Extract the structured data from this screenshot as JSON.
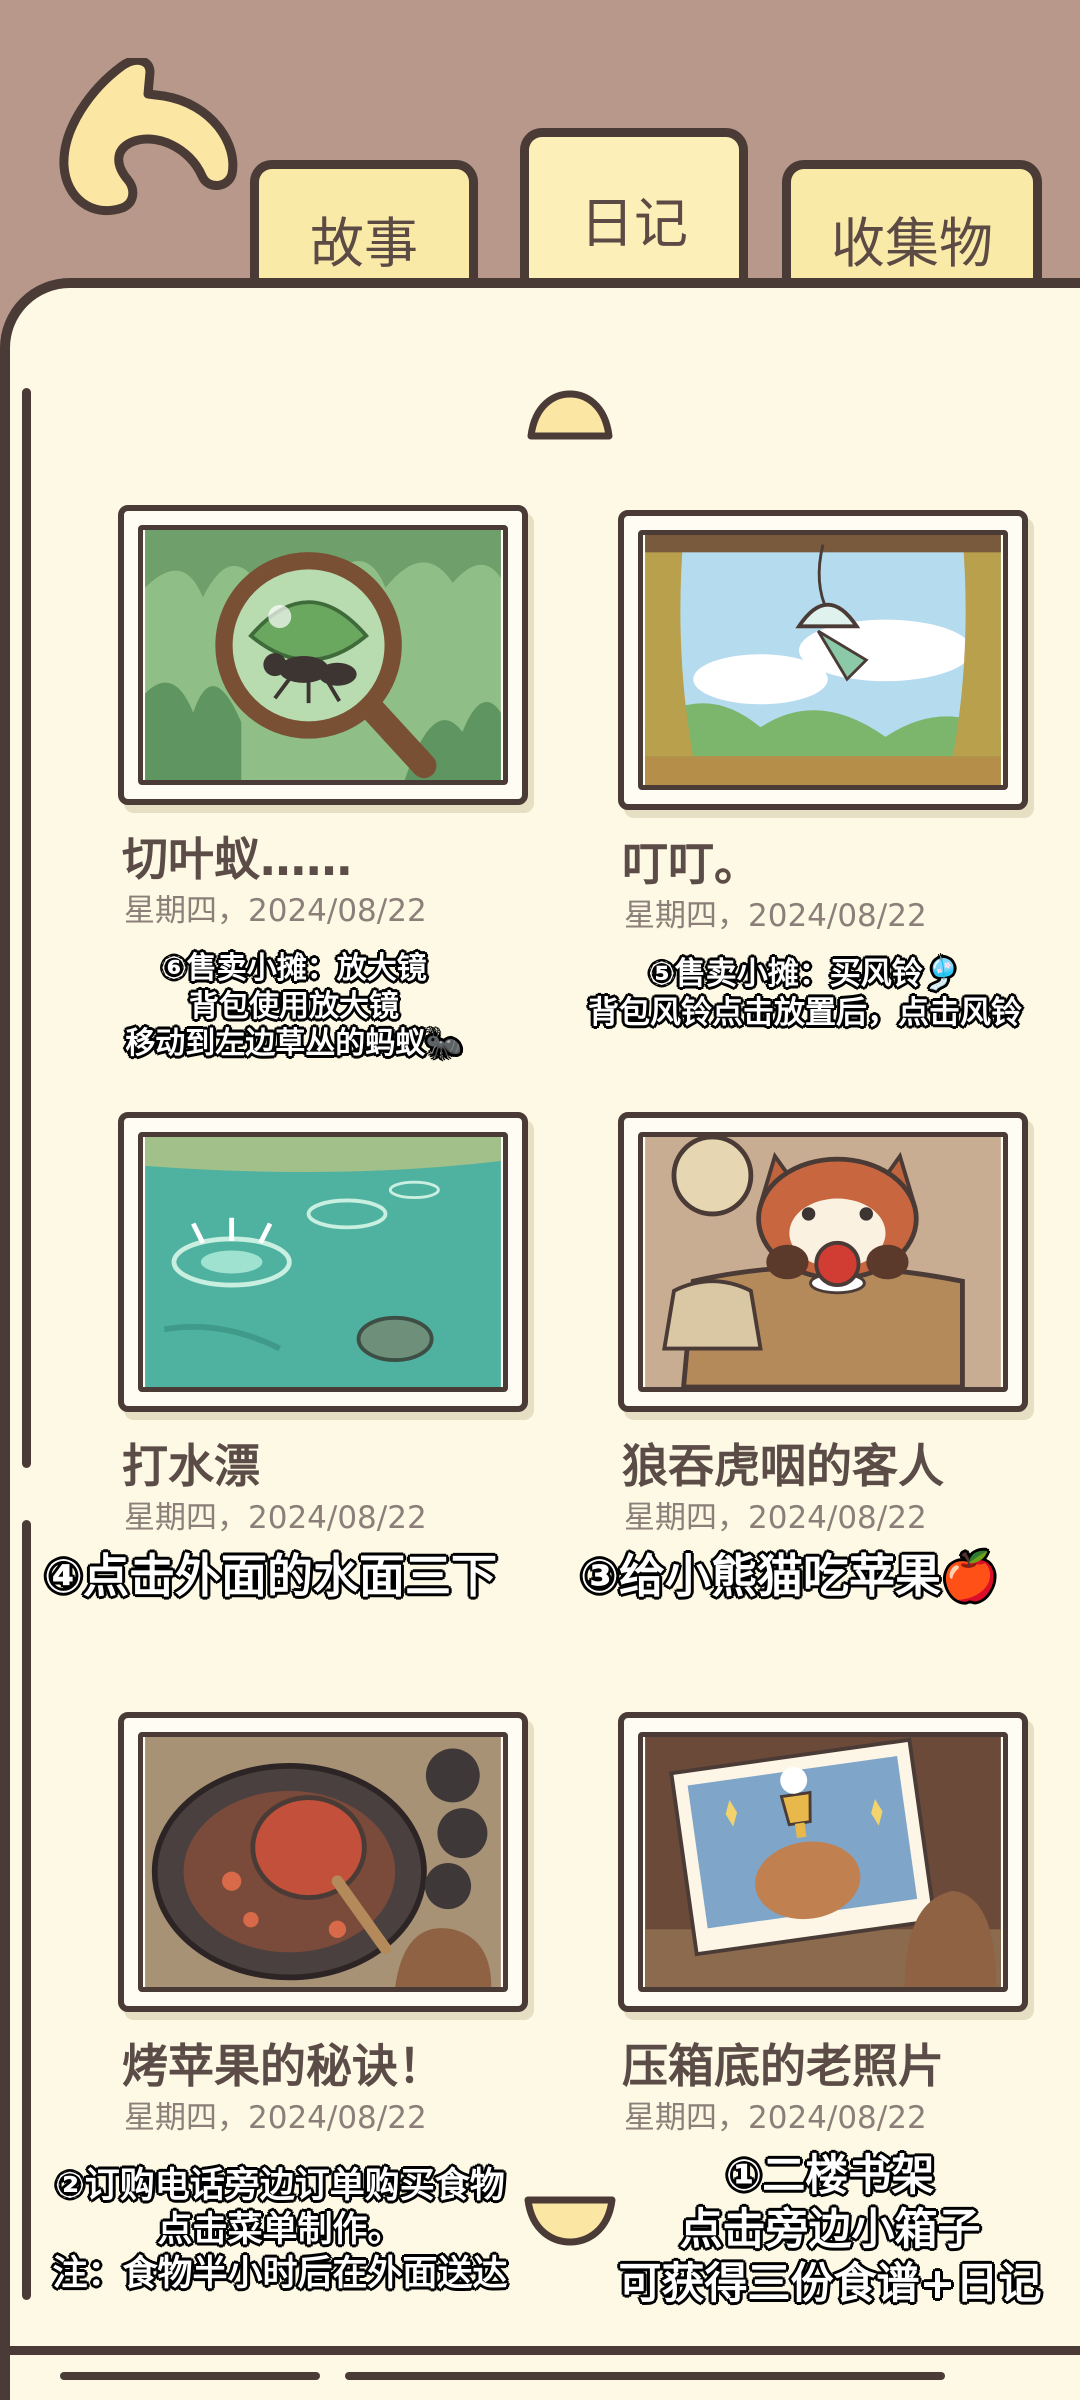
{
  "tabs": {
    "story": "故事",
    "diary": "日记",
    "collection": "收集物"
  },
  "entries": [
    {
      "title": "切叶蚁……",
      "date": "星期四，2024/08/22",
      "scene": "magnifier-ant"
    },
    {
      "title": "叮叮。",
      "date": "星期四，2024/08/22",
      "scene": "window-wind-chime"
    },
    {
      "title": "打水漂",
      "date": "星期四，2024/08/22",
      "scene": "pond-splash"
    },
    {
      "title": "狼吞虎咽的客人",
      "date": "星期四，2024/08/22",
      "scene": "red-panda-apple"
    },
    {
      "title": "烤苹果的秘诀！",
      "date": "星期四，2024/08/22",
      "scene": "baked-apple-pan"
    },
    {
      "title": "压箱底的老照片",
      "date": "星期四，2024/08/22",
      "scene": "old-photo-trophy"
    }
  ],
  "annotations": {
    "n6": [
      "⑥售卖小摊：放大镜",
      "背包使用放大镜",
      "移动到左边草丛的蚂蚁🐜"
    ],
    "n5": [
      "⑤售卖小摊：买风铃🎐",
      "背包风铃点击放置后，点击风铃"
    ],
    "n4": [
      "④点击外面的水面三下"
    ],
    "n3": [
      "③给小熊猫吃苹果🍎"
    ],
    "n2": [
      "②订购电话旁边订单购买食物",
      "点击菜单制作。",
      "注：食物半小时后在外面送达"
    ],
    "n1": [
      "①二楼书架",
      "点击旁边小箱子",
      "可获得三份食谱+日记"
    ]
  },
  "colors": {
    "outline": "#4a3b36",
    "page": "#fdf9e4",
    "tab": "#faeaa8",
    "background": "#b7988a"
  }
}
